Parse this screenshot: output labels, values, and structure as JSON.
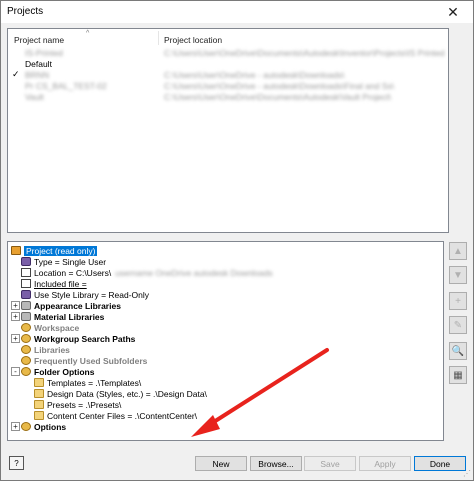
{
  "window": {
    "title": "Projects",
    "close_glyph": "✕"
  },
  "projects": {
    "columns": {
      "name": "Project name",
      "location": "Project location"
    },
    "sort_glyph": "^",
    "rows": [
      {
        "check": "",
        "name": "IS-Printed",
        "location": "C:\\Users\\User\\OneDrive\\Documents\\Autodesk\\Inventor\\Projects\\IS Printed",
        "blurred": true
      },
      {
        "check": "",
        "name": "Default",
        "location": "",
        "blurred": false
      },
      {
        "check": "✓",
        "name": "BRNN",
        "location": "C:\\Users\\User\\OneDrive - autodesk\\Downloads\\",
        "blurred": true
      },
      {
        "check": "",
        "name": "Pr CS_BAL_TEST-02",
        "location": "C:\\Users\\User\\OneDrive - autodesk\\Downloads\\Final and Ss\\",
        "blurred": true
      },
      {
        "check": "",
        "name": "Vault",
        "location": "C:\\Users\\User\\OneDrive\\Documents\\Autodesk\\Vault Project\\",
        "blurred": true
      }
    ]
  },
  "tree": {
    "project_root": "Project (read only)",
    "type": "Type = Single User",
    "location_prefix": "Location = C:\\Users\\",
    "location_blur": "username OneDrive  autodesk  Downloads",
    "included_file": "Included file = ",
    "style_library": "Use Style Library = Read-Only",
    "appearance": "Appearance Libraries",
    "material": "Material Libraries",
    "workspace": "Workspace",
    "workgroup": "Workgroup Search Paths",
    "libraries": "Libraries",
    "freq": "Frequently Used Subfolders",
    "folder_options": "Folder Options",
    "templates": "Templates = .\\Templates\\",
    "design_data": "Design Data (Styles, etc.) = .\\Design Data\\",
    "presets": "Presets = .\\Presets\\",
    "content_center": "Content Center Files = .\\ContentCenter\\",
    "options": "Options",
    "expand_plus": "+",
    "expand_minus": "-"
  },
  "side_buttons": {
    "up": "▲",
    "down": "▼",
    "add": "+",
    "edit": "✎",
    "find": "🔍",
    "save": "▦"
  },
  "buttons": {
    "help": "?",
    "new": "New",
    "browse": "Browse...",
    "save": "Save",
    "apply": "Apply",
    "done": "Done"
  },
  "colors": {
    "selection": "#0078d7",
    "arrow": "#e8231d"
  }
}
